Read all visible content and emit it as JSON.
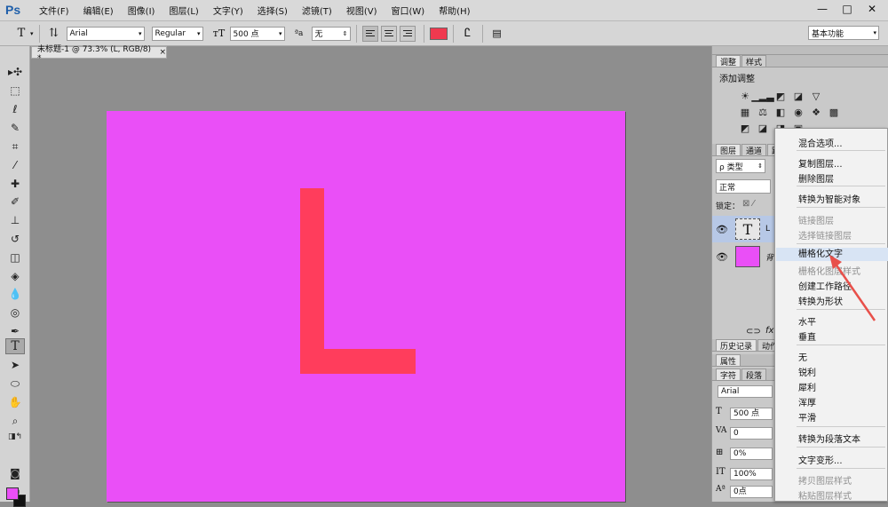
{
  "menubar": {
    "logo": "Ps",
    "items": [
      "文件(F)",
      "编辑(E)",
      "图像(I)",
      "图层(L)",
      "文字(Y)",
      "选择(S)",
      "滤镜(T)",
      "视图(V)",
      "窗口(W)",
      "帮助(H)"
    ],
    "window_controls": [
      "—",
      "□",
      "✕"
    ]
  },
  "options": {
    "font_family": "Arial",
    "font_style": "Regular",
    "font_size": "500 点",
    "anti_alias": "无",
    "workspace": "基本功能",
    "text_color": "#f0394f"
  },
  "document": {
    "tab_title": "未标题-1 @ 73.3% (L, RGB/8) *",
    "tab_close": "×",
    "canvas_color": "#ea4ff7",
    "text": "L",
    "text_color": "#ff3d5c"
  },
  "tools": {
    "fg_color": "#ea4ff7",
    "bg_color": "#111111"
  },
  "adjustments": {
    "tabs": [
      "调整",
      "样式"
    ],
    "title": "添加调整"
  },
  "layers": {
    "tabs": [
      "图层",
      "通道",
      "路"
    ],
    "filter": "ρ 类型",
    "blend": "正常",
    "lock_label": "锁定：",
    "text_layer_name": "L",
    "bg_layer_name": "背"
  },
  "bottom_tabs": {
    "history": "历史记录",
    "actions": "动作",
    "properties": "属性"
  },
  "character": {
    "tabs": [
      "字符",
      "段落"
    ],
    "font": "Arial",
    "size": "500 点",
    "kerning": "0",
    "tracking": "0%",
    "vscale": "100%",
    "baseline": "0点"
  },
  "context_menu": {
    "items": [
      {
        "label": "混合选项...",
        "disabled": false
      },
      {
        "label": "复制图层...",
        "disabled": false
      },
      {
        "label": "删除图层",
        "disabled": false
      },
      {
        "label": "转换为智能对象",
        "disabled": false
      },
      {
        "label": "链接图层",
        "disabled": true
      },
      {
        "label": "选择链接图层",
        "disabled": true
      },
      {
        "label": "栅格化文字",
        "disabled": false,
        "highlighted": true
      },
      {
        "label": "栅格化图层样式",
        "disabled": true
      },
      {
        "label": "创建工作路径",
        "disabled": false
      },
      {
        "label": "转换为形状",
        "disabled": false
      },
      {
        "label": "水平",
        "disabled": false
      },
      {
        "label": "垂直",
        "disabled": false
      },
      {
        "label": "无",
        "disabled": false
      },
      {
        "label": "锐利",
        "disabled": false
      },
      {
        "label": "犀利",
        "disabled": false
      },
      {
        "label": "浑厚",
        "disabled": false
      },
      {
        "label": "平滑",
        "disabled": false
      },
      {
        "label": "转换为段落文本",
        "disabled": false
      },
      {
        "label": "文字变形...",
        "disabled": false
      },
      {
        "label": "拷贝图层样式",
        "disabled": true
      },
      {
        "label": "粘贴图层样式",
        "disabled": true
      }
    ],
    "highlight_color": "#d8e4f4"
  },
  "annotation": {
    "arrow_color": "#e8504a"
  }
}
